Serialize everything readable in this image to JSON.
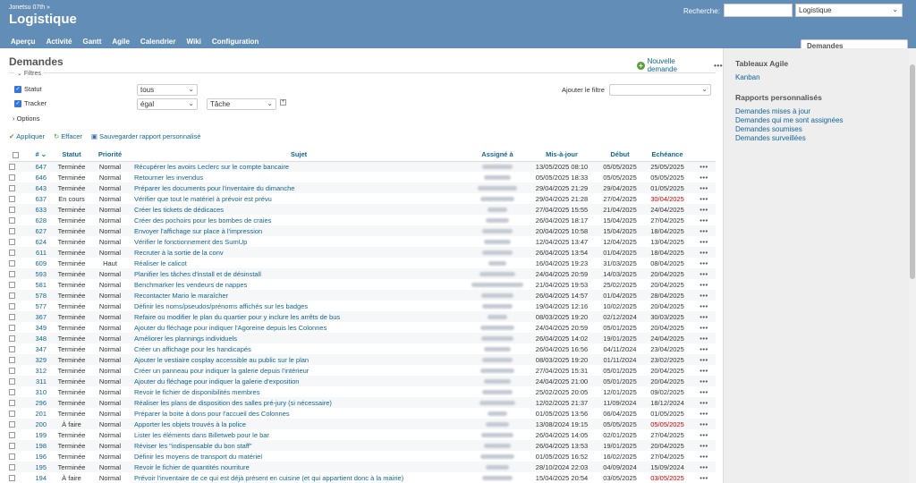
{
  "header": {
    "project_path": "Jonetsu 07th »",
    "title": "Logistique",
    "search_label": "Recherche:",
    "search_value": "",
    "project_select": "Logistique"
  },
  "tabs": [
    "Aperçu",
    "Activité",
    "Demandes",
    "Gantt",
    "Agile",
    "Calendrier",
    "Wiki",
    "Configuration"
  ],
  "selected_tab": "Demandes",
  "page": {
    "title": "Demandes",
    "new_issue": "Nouvelle demande",
    "more": "•••"
  },
  "filters": {
    "legend": "Filtres",
    "statut_label": "Statut",
    "statut_op": "tous",
    "tracker_label": "Tracker",
    "tracker_op": "égal",
    "tracker_value": "Tâche",
    "add_filter_label": "Ajouter le filtre",
    "add_filter_value": "",
    "options_label": "Options"
  },
  "actions": {
    "apply": "Appliquer",
    "clear": "Effacer",
    "save": "Sauvegarder rapport personnalisé"
  },
  "columns": {
    "id": "#",
    "status": "Statut",
    "priority": "Priorité",
    "subject": "Sujet",
    "assignee": "Assigné à",
    "updated": "Mis-à-jour",
    "start": "Début",
    "due": "Echéance"
  },
  "issues": [
    {
      "id": "647",
      "status": "Terminée",
      "priority": "Normal",
      "subject": "Récupérer les avoirs Leclerc sur le compte bancaire",
      "updated": "13/05/2025 08:10",
      "start": "05/05/2025",
      "due": "25/05/2025",
      "late": false
    },
    {
      "id": "646",
      "status": "Terminée",
      "priority": "Normal",
      "subject": "Retourner les invendus",
      "updated": "05/05/2025 18:33",
      "start": "05/05/2025",
      "due": "05/05/2025",
      "late": false
    },
    {
      "id": "643",
      "status": "Terminée",
      "priority": "Normal",
      "subject": "Préparer les documents pour l'inventaire du dimanche",
      "updated": "29/04/2025 21:29",
      "start": "29/04/2025",
      "due": "01/05/2025",
      "late": false
    },
    {
      "id": "637",
      "status": "En cours",
      "priority": "Normal",
      "subject": "Vérifier que tout le matériel à prévoir est prévu",
      "updated": "29/04/2025 21:28",
      "start": "27/04/2025",
      "due": "30/04/2025",
      "late": true
    },
    {
      "id": "633",
      "status": "Terminée",
      "priority": "Normal",
      "subject": "Créer les tickets de dédicaces",
      "updated": "27/04/2025 15:55",
      "start": "21/04/2025",
      "due": "24/04/2025",
      "late": false
    },
    {
      "id": "628",
      "status": "Terminée",
      "priority": "Normal",
      "subject": "Créer des pochoirs pour les bombes de craies",
      "updated": "26/04/2025 18:17",
      "start": "15/04/2025",
      "due": "27/04/2025",
      "late": false
    },
    {
      "id": "627",
      "status": "Terminée",
      "priority": "Normal",
      "subject": "Envoyer l'affichage sur place à l'impression",
      "updated": "20/04/2025 10:58",
      "start": "15/04/2025",
      "due": "18/04/2025",
      "late": false
    },
    {
      "id": "624",
      "status": "Terminée",
      "priority": "Normal",
      "subject": "Vérifier le fonctionnement des SumUp",
      "updated": "12/04/2025 13:47",
      "start": "12/04/2025",
      "due": "13/04/2025",
      "late": false
    },
    {
      "id": "611",
      "status": "Terminée",
      "priority": "Normal",
      "subject": "Recruter à la sortie de la conv",
      "updated": "26/04/2025 13:54",
      "start": "01/04/2025",
      "due": "18/04/2025",
      "late": false
    },
    {
      "id": "609",
      "status": "Terminée",
      "priority": "Haut",
      "subject": "Réaliser le calicot",
      "updated": "16/04/2025 19:23",
      "start": "31/03/2025",
      "due": "08/04/2025",
      "late": false
    },
    {
      "id": "593",
      "status": "Terminée",
      "priority": "Normal",
      "subject": "Planifier les tâches d'install et de désinstall",
      "updated": "24/04/2025 20:59",
      "start": "14/03/2025",
      "due": "20/04/2025",
      "late": false
    },
    {
      "id": "581",
      "status": "Terminée",
      "priority": "Normal",
      "subject": "Benchmarker les vendeurs de nappes",
      "updated": "21/04/2025 19:53",
      "start": "25/02/2025",
      "due": "20/04/2025",
      "late": false
    },
    {
      "id": "578",
      "status": "Terminée",
      "priority": "Normal",
      "subject": "Recontacter Mario le maraîcher",
      "updated": "26/04/2025 14:57",
      "start": "01/04/2025",
      "due": "28/04/2025",
      "late": false
    },
    {
      "id": "577",
      "status": "Terminée",
      "priority": "Normal",
      "subject": "Définir les noms/pseudos/prénoms affichés sur les badges",
      "updated": "19/04/2025 12:16",
      "start": "10/02/2025",
      "due": "20/04/2025",
      "late": false
    },
    {
      "id": "367",
      "status": "Terminée",
      "priority": "Normal",
      "subject": "Refaire ou modifier le plan du quartier pour y inclure les arrêts de bus",
      "updated": "08/03/2025 19:20",
      "start": "02/12/2024",
      "due": "30/03/2025",
      "late": false
    },
    {
      "id": "349",
      "status": "Terminée",
      "priority": "Normal",
      "subject": "Ajouter du fléchage pour indiquer l'Agoreine depuis les Colonnes",
      "updated": "24/04/2025 20:59",
      "start": "05/01/2025",
      "due": "20/04/2025",
      "late": false
    },
    {
      "id": "348",
      "status": "Terminée",
      "priority": "Normal",
      "subject": "Améliorer les plannings individuels",
      "updated": "26/04/2025 14:02",
      "start": "19/01/2025",
      "due": "24/04/2025",
      "late": false
    },
    {
      "id": "347",
      "status": "Terminée",
      "priority": "Normal",
      "subject": "Créer un affichage pour les handicapés",
      "updated": "26/04/2025 16:56",
      "start": "04/11/2024",
      "due": "23/04/2025",
      "late": false
    },
    {
      "id": "329",
      "status": "Terminée",
      "priority": "Normal",
      "subject": "Ajouter le vestiaire cosplay accessible au public sur le plan",
      "updated": "08/03/2025 19:20",
      "start": "01/11/2024",
      "due": "23/02/2025",
      "late": false
    },
    {
      "id": "312",
      "status": "Terminée",
      "priority": "Normal",
      "subject": "Créer un panneau pour indiquer la galerie depuis l'intérieur",
      "updated": "27/04/2025 15:31",
      "start": "05/01/2025",
      "due": "20/04/2025",
      "late": false
    },
    {
      "id": "311",
      "status": "Terminée",
      "priority": "Normal",
      "subject": "Ajouter du fléchage pour indiquer la galerie d'exposition",
      "updated": "24/04/2025 21:00",
      "start": "05/01/2025",
      "due": "20/04/2025",
      "late": false
    },
    {
      "id": "310",
      "status": "Terminée",
      "priority": "Normal",
      "subject": "Revoir le fichier de disponibilités membres",
      "updated": "25/02/2025 20:05",
      "start": "12/01/2025",
      "due": "09/02/2025",
      "late": false
    },
    {
      "id": "296",
      "status": "Terminée",
      "priority": "Normal",
      "subject": "Réaliser les plans de disposition des salles pré-jury (si nécessaire)",
      "updated": "12/02/2025 21:37",
      "start": "11/09/2024",
      "due": "18/12/2024",
      "late": false
    },
    {
      "id": "201",
      "status": "Terminée",
      "priority": "Normal",
      "subject": "Préparer la boite à dons pour l'accueil des Colonnes",
      "updated": "01/05/2025 13:56",
      "start": "06/04/2025",
      "due": "01/05/2025",
      "late": false
    },
    {
      "id": "200",
      "status": "À faire",
      "priority": "Normal",
      "subject": "Apporter les objets trouvés à la police",
      "updated": "13/08/2024 19:15",
      "start": "05/05/2025",
      "due": "05/05/2025",
      "late": true
    },
    {
      "id": "199",
      "status": "Terminée",
      "priority": "Normal",
      "subject": "Lister les éléments dans Billetweb pour le bar",
      "updated": "26/04/2025 14:05",
      "start": "02/01/2025",
      "due": "27/04/2025",
      "late": false
    },
    {
      "id": "198",
      "status": "Terminée",
      "priority": "Normal",
      "subject": "Réviser les \"indispensable du bon staff\"",
      "updated": "26/04/2025 13:53",
      "start": "19/01/2025",
      "due": "20/04/2025",
      "late": false
    },
    {
      "id": "196",
      "status": "Terminée",
      "priority": "Normal",
      "subject": "Définir les moyens de transport du matériel",
      "updated": "01/05/2025 16:52",
      "start": "16/02/2025",
      "due": "27/04/2025",
      "late": false
    },
    {
      "id": "195",
      "status": "Terminée",
      "priority": "Normal",
      "subject": "Revoir le fichier de quantités nourriture",
      "updated": "28/10/2024 22:03",
      "start": "04/09/2024",
      "due": "15/09/2024",
      "late": false
    },
    {
      "id": "194",
      "status": "À faire",
      "priority": "Normal",
      "subject": "Prévoir l'inventaire de ce qui est déjà présent en cuisine (et qui appartient donc à la mairie)",
      "updated": "15/04/2025 20:54",
      "start": "03/05/2025",
      "due": "03/05/2025",
      "late": true
    }
  ],
  "sidebar": {
    "agile_title": "Tableaux Agile",
    "agile_links": [
      "Kanban"
    ],
    "reports_title": "Rapports personnalisés",
    "report_links": [
      "Demandes mises à jour",
      "Demandes qui me sont assignées",
      "Demandes soumises",
      "Demandes surveillées"
    ]
  }
}
